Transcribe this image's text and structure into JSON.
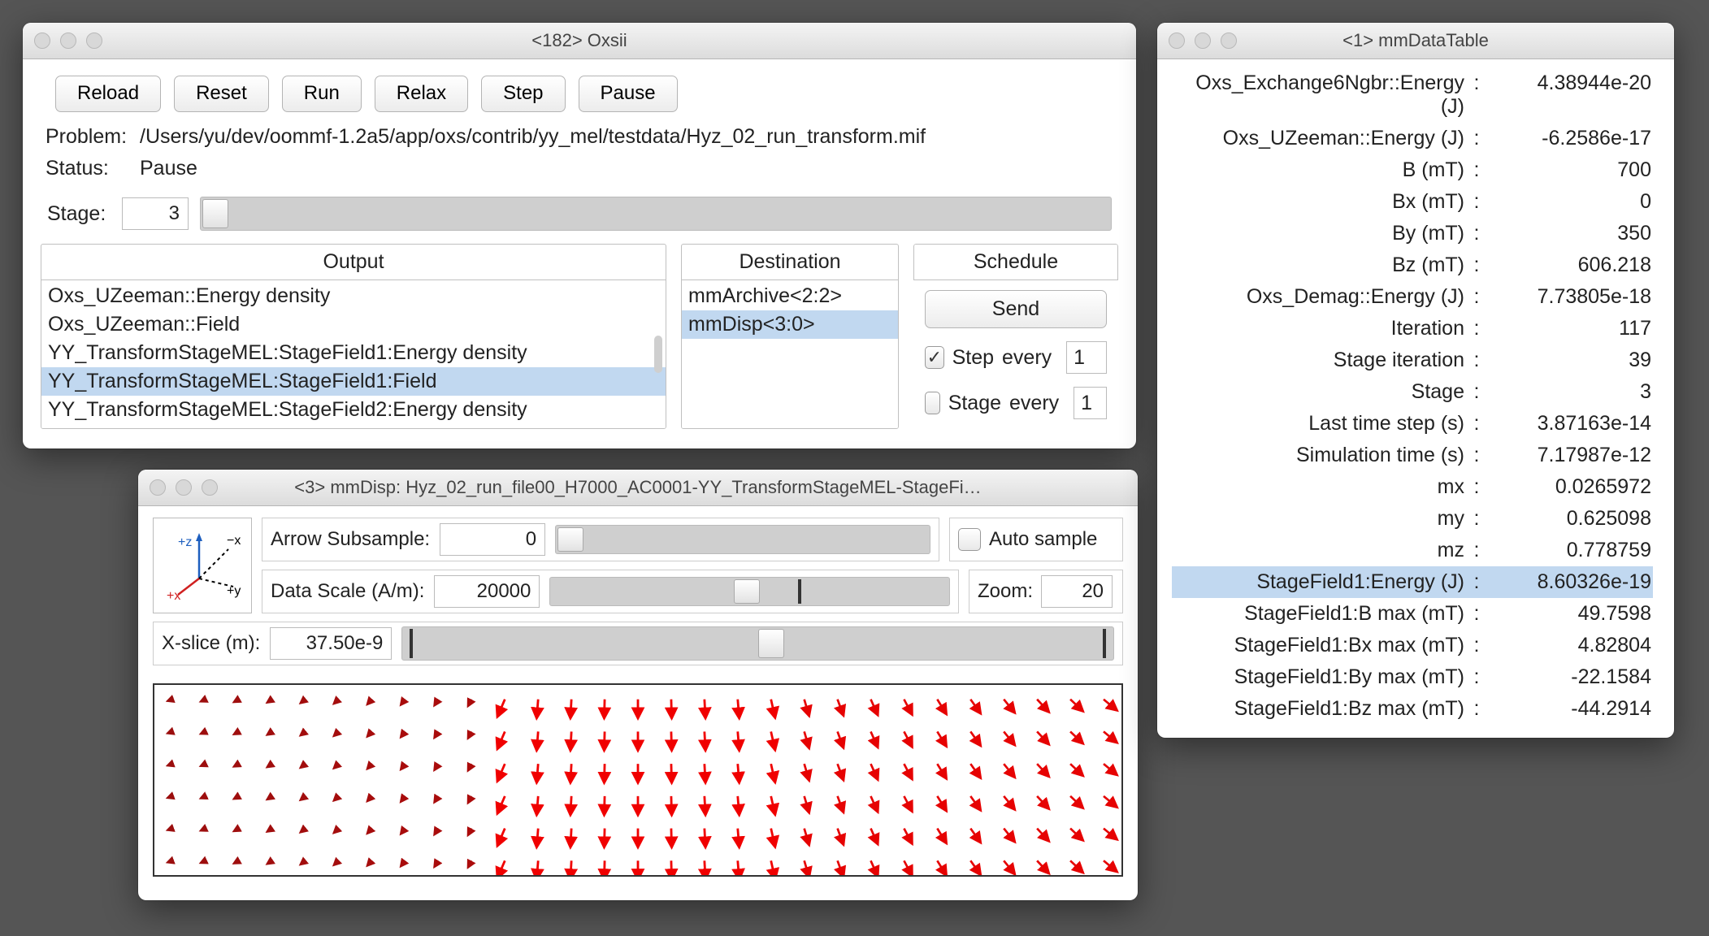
{
  "oxsii": {
    "title": "<182> Oxsii",
    "buttons": {
      "reload": "Reload",
      "reset": "Reset",
      "run": "Run",
      "relax": "Relax",
      "step": "Step",
      "pause": "Pause"
    },
    "problem_label": "Problem:",
    "problem": "/Users/yu/dev/oommf-1.2a5/app/oxs/contrib/yy_mel/testdata/Hyz_02_run_transform.mif",
    "status_label": "Status:",
    "status": "Pause",
    "stage_label": "Stage:",
    "stage_value": "3",
    "columns": {
      "output": "Output",
      "destination": "Destination",
      "schedule": "Schedule"
    },
    "outputs": [
      {
        "text": "Oxs_UZeeman::Energy density",
        "selected": false
      },
      {
        "text": "Oxs_UZeeman::Field",
        "selected": false
      },
      {
        "text": "YY_TransformStageMEL:StageField1:Energy density",
        "selected": false
      },
      {
        "text": "YY_TransformStageMEL:StageField1:Field",
        "selected": true
      },
      {
        "text": "YY_TransformStageMEL:StageField2:Energy density",
        "selected": false
      }
    ],
    "destinations": [
      {
        "text": "mmArchive<2:2>",
        "selected": false
      },
      {
        "text": "mmDisp<3:0>",
        "selected": true
      }
    ],
    "schedule": {
      "send": "Send",
      "step_label": "Step",
      "step_checked": true,
      "step_every_label": "every",
      "step_every": "1",
      "stage_label": "Stage",
      "stage_checked": false,
      "stage_every_label": "every",
      "stage_every": "1"
    }
  },
  "mmdisp": {
    "title": "<3> mmDisp: Hyz_02_run_file00_H7000_AC0001-YY_TransformStageMEL-StageFi…",
    "arrow_label": "Arrow Subsample:",
    "arrow_value": "0",
    "auto_label": "Auto sample",
    "auto_checked": false,
    "scale_label": "Data Scale (A/m):",
    "scale_value": "20000",
    "zoom_label": "Zoom:",
    "zoom_value": "20",
    "xslice_label": "X-slice (m):",
    "xslice_value": "37.50e-9",
    "axis": {
      "pz": "+z",
      "mx": "-x",
      "py": "+y",
      "px": "+x"
    },
    "vectors": {
      "rows": 6,
      "cols": 29,
      "comment": "Arrow field represents YY_TransformStageMEL:StageField1:Field on the selected X-slice. Left region arrows are short (low magnitude), tilted down-left; center region arrows are longer, pointing straight down; right region arrows tilt down-right. Color varies from dark maroon (small magnitude) to bright red (large magnitude)."
    }
  },
  "datatable": {
    "title": "<1> mmDataTable",
    "rows": [
      {
        "label": "Oxs_Exchange6Ngbr::Energy (J)",
        "value": "4.38944e-20",
        "selected": false
      },
      {
        "label": "Oxs_UZeeman::Energy (J)",
        "value": "-6.2586e-17",
        "selected": false
      },
      {
        "label": "B (mT)",
        "value": "700",
        "selected": false
      },
      {
        "label": "Bx (mT)",
        "value": "0",
        "selected": false
      },
      {
        "label": "By (mT)",
        "value": "350",
        "selected": false
      },
      {
        "label": "Bz (mT)",
        "value": "606.218",
        "selected": false
      },
      {
        "label": "Oxs_Demag::Energy (J)",
        "value": "7.73805e-18",
        "selected": false
      },
      {
        "label": "Iteration",
        "value": "117",
        "selected": false
      },
      {
        "label": "Stage iteration",
        "value": "39",
        "selected": false
      },
      {
        "label": "Stage",
        "value": "3",
        "selected": false
      },
      {
        "label": "Last time step (s)",
        "value": "3.87163e-14",
        "selected": false
      },
      {
        "label": "Simulation time (s)",
        "value": "7.17987e-12",
        "selected": false
      },
      {
        "label": "mx",
        "value": "0.0265972",
        "selected": false
      },
      {
        "label": "my",
        "value": "0.625098",
        "selected": false
      },
      {
        "label": "mz",
        "value": "0.778759",
        "selected": false
      },
      {
        "label": "StageField1:Energy (J)",
        "value": "8.60326e-19",
        "selected": true
      },
      {
        "label": "StageField1:B max (mT)",
        "value": "49.7598",
        "selected": false
      },
      {
        "label": "StageField1:Bx max (mT)",
        "value": "4.82804",
        "selected": false
      },
      {
        "label": "StageField1:By max (mT)",
        "value": "-22.1584",
        "selected": false
      },
      {
        "label": "StageField1:Bz max (mT)",
        "value": "-44.2914",
        "selected": false
      }
    ]
  }
}
